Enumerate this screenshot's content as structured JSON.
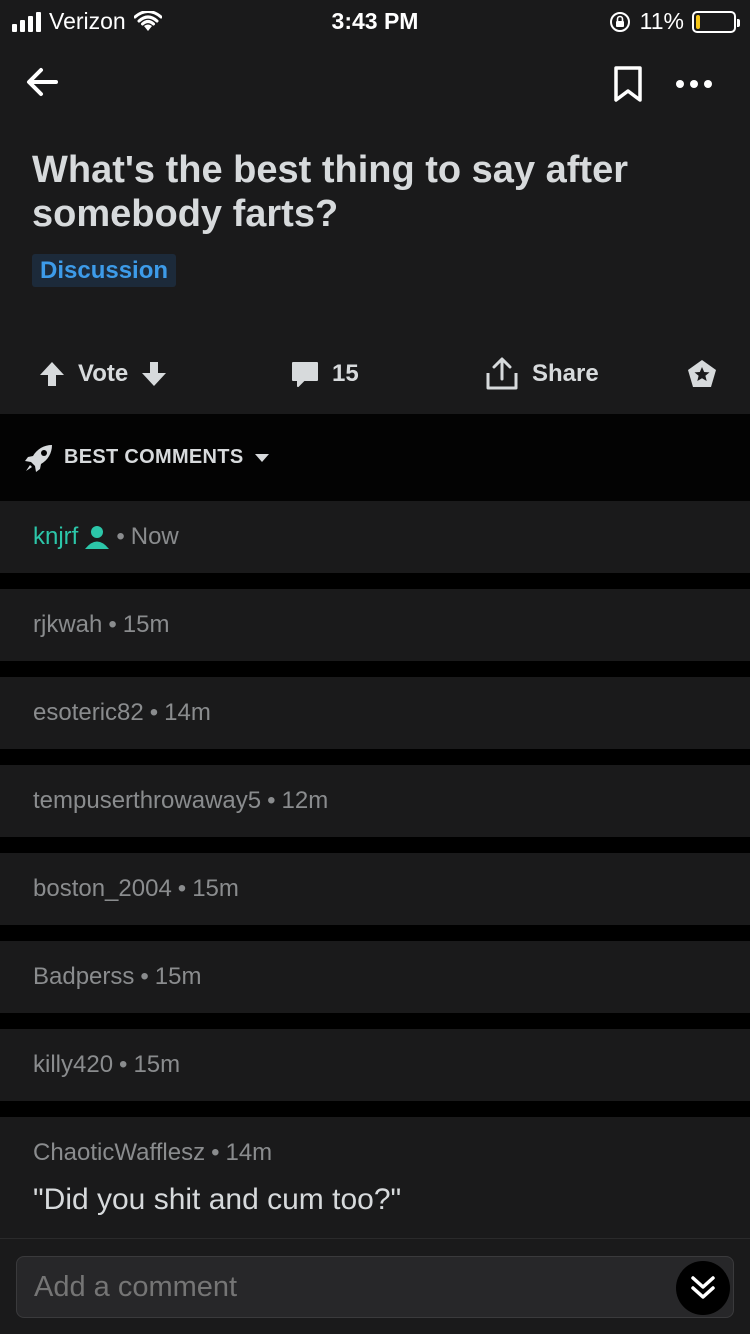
{
  "status_bar": {
    "carrier": "Verizon",
    "time": "3:43 PM",
    "battery": "11%",
    "battery_level": 0.11
  },
  "post": {
    "title": "What's the best thing to say after somebody farts?",
    "flair": "Discussion",
    "vote_label": "Vote",
    "comment_count": "15",
    "share_label": "Share"
  },
  "sort": {
    "label": "BEST COMMENTS"
  },
  "comments": [
    {
      "author": "knjrf",
      "time": "Now"
    },
    {
      "author": "rjkwah",
      "time": "15m"
    },
    {
      "author": "esoteric82",
      "time": "14m"
    },
    {
      "author": "tempuserthrowaway5",
      "time": "12m"
    },
    {
      "author": "boston_2004",
      "time": "15m"
    },
    {
      "author": "Badperss",
      "time": "15m"
    },
    {
      "author": "killy420",
      "time": "15m"
    },
    {
      "author": "ChaoticWafflesz",
      "time": "14m",
      "body": "\"Did you shit and cum too?\""
    }
  ],
  "composer": {
    "placeholder": "Add a comment"
  },
  "colors": {
    "accent": "#2cc6a9",
    "flair": "#3d9be9",
    "battery": "#f5c518"
  }
}
